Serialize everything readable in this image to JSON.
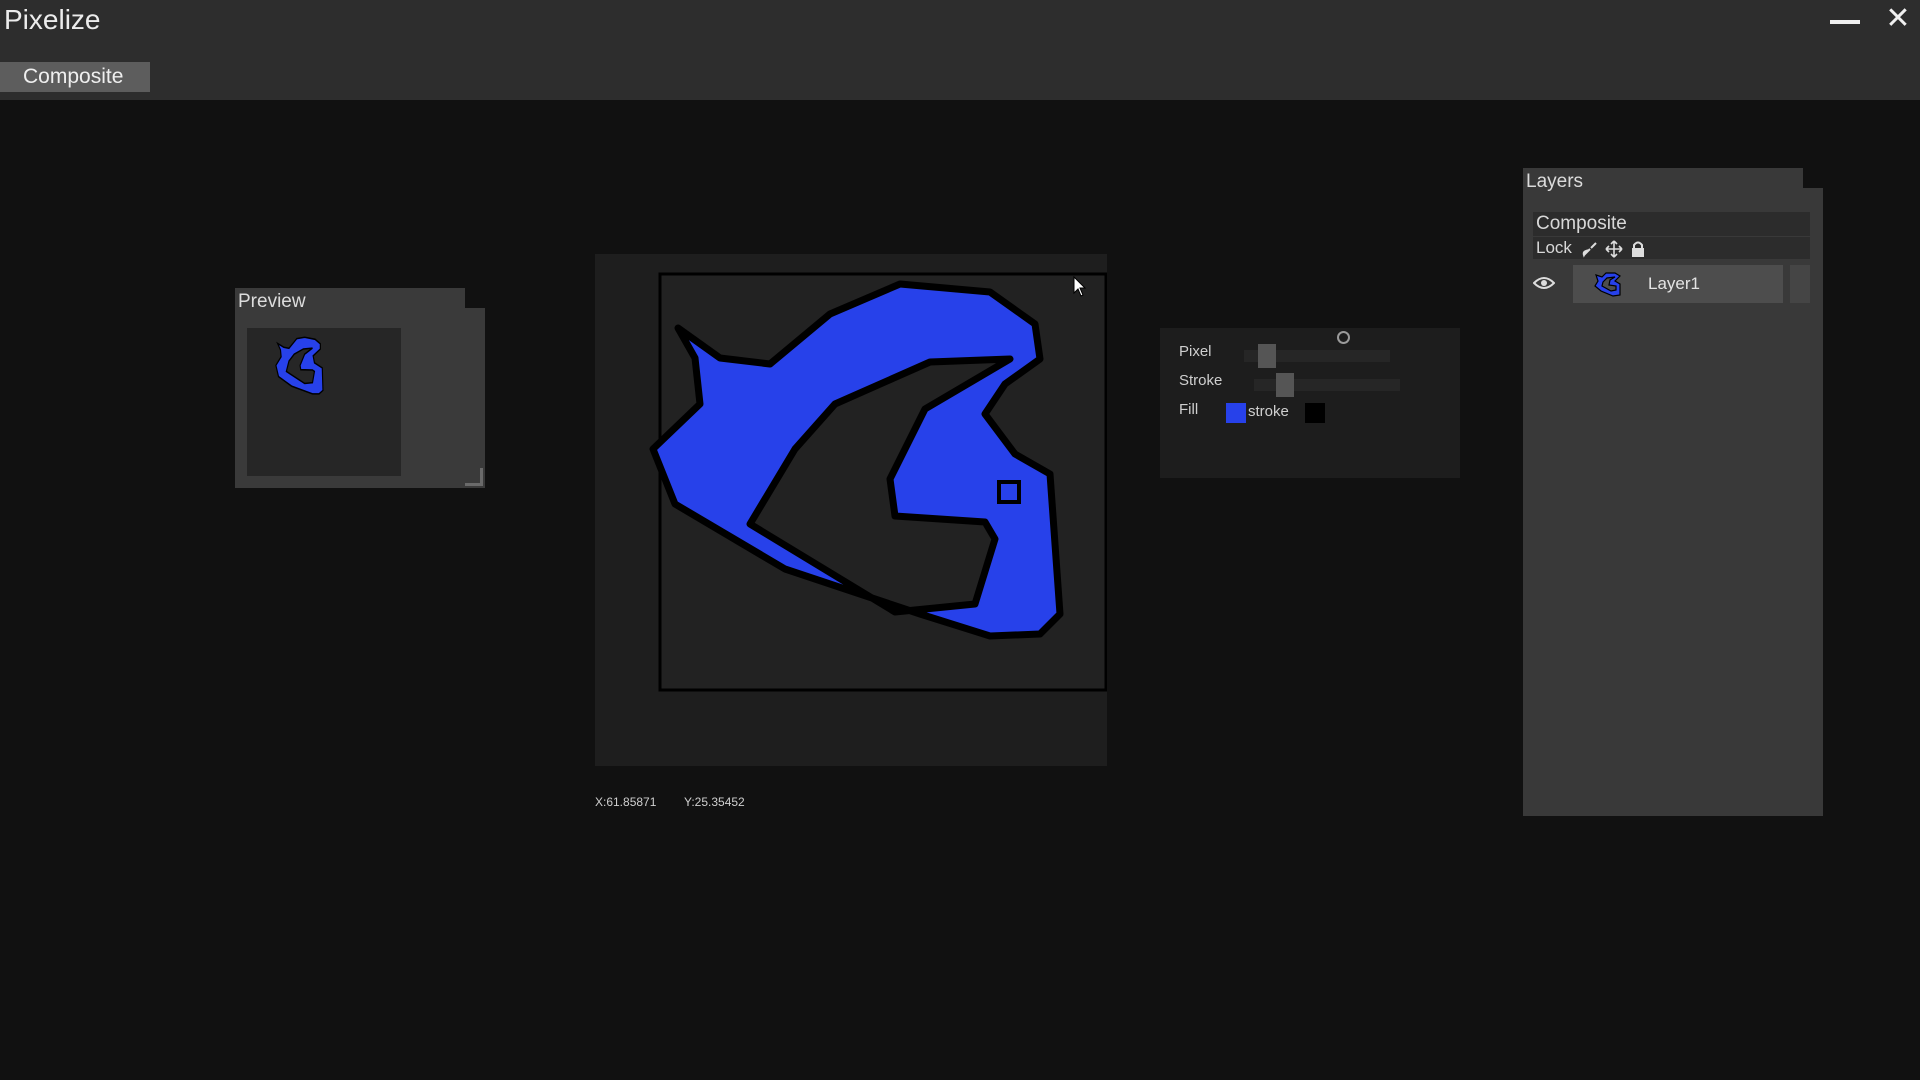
{
  "app": {
    "title": "Pixelize"
  },
  "toolbar": {
    "tab_label": "Composite"
  },
  "preview": {
    "title": "Preview"
  },
  "canvas": {
    "fill_color": "#2741ea",
    "stroke_color": "#000000",
    "background": "#1e1e1e"
  },
  "status": {
    "x": "X:61.85871",
    "y": "Y:25.35452"
  },
  "properties": {
    "pixel_label": "Pixel",
    "stroke_label": "Stroke",
    "fill_label": "Fill",
    "stroke_swatch_label": "stroke",
    "fill_color": "#2741ea",
    "stroke_color": "#000000"
  },
  "layers": {
    "title": "Layers",
    "composite_label": "Composite",
    "lock_label": "Lock",
    "lock_icons": [
      "brush-icon",
      "move-icon",
      "lock-icon"
    ],
    "items": [
      {
        "name": "Layer1",
        "visible": true
      }
    ]
  }
}
